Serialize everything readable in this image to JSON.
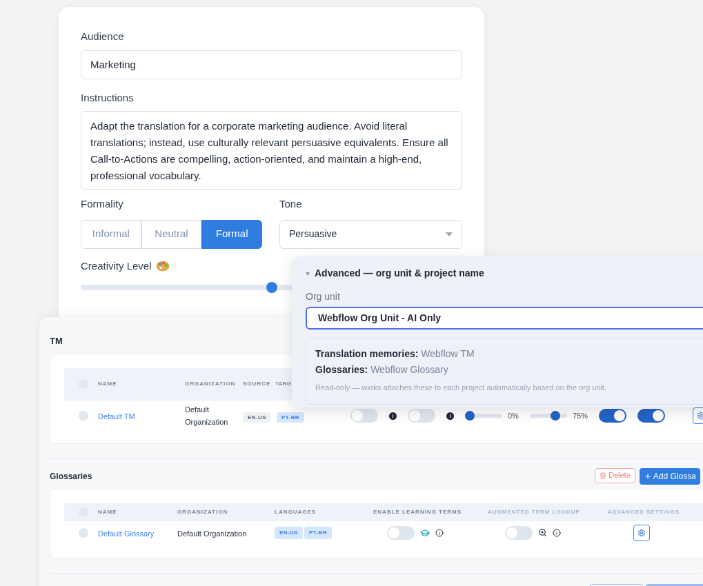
{
  "form": {
    "audience": {
      "label": "Audience",
      "value": "Marketing"
    },
    "instructions": {
      "label": "Instructions",
      "value": "Adapt the translation for a corporate marketing audience. Avoid literal translations; instead, use culturally relevant persuasive equivalents. Ensure all Call-to-Actions are compelling, action-oriented, and maintain a high-end, professional vocabulary."
    },
    "formality": {
      "label": "Formality",
      "options": [
        {
          "label": "Informal",
          "selected": false
        },
        {
          "label": "Neutral",
          "selected": false
        },
        {
          "label": "Formal",
          "selected": true
        }
      ]
    },
    "tone": {
      "label": "Tone",
      "value": "Persuasive"
    },
    "creativity": {
      "label": "Creativity Level",
      "level": 0.5
    }
  },
  "tm": {
    "title": "TM",
    "header_checked": false,
    "columns": [
      "NAME",
      "ORGANIZATION",
      "SOURCE",
      "TARG"
    ],
    "rows": [
      {
        "checked": false,
        "name": "Default TM",
        "organization": "Default Organization",
        "source": "EN-US",
        "target": "PT-BR",
        "controls": [
          {
            "kind": "toggle",
            "on": false
          },
          {
            "kind": "info"
          },
          {
            "kind": "toggle",
            "on": false
          },
          {
            "kind": "info"
          },
          {
            "kind": "slider",
            "level": 0,
            "reading": "0%"
          },
          {
            "kind": "slider",
            "level": 0.75,
            "reading": "75%"
          },
          {
            "kind": "toggle",
            "on": true
          },
          {
            "kind": "toggle",
            "on": true
          },
          {
            "kind": "settings"
          }
        ]
      }
    ]
  },
  "glossaries": {
    "title": "Glossaries",
    "header_checked": false,
    "buttons": [
      {
        "kind": "danger",
        "label": "Delete"
      },
      {
        "kind": "primary",
        "label": "Add Glossa"
      }
    ],
    "columns": [
      "NAME",
      "ORGANIZATION",
      "LANGUAGES",
      "ENABLE LEARNING TERMS",
      "AUGMENTED TERM LOOKUP",
      "ADVANCED SETTINGS"
    ],
    "rows": [
      {
        "checked": false,
        "name": "Default Glossary",
        "organization": "Default Organization",
        "languages": [
          "EN-US",
          "PT-BR"
        ],
        "learning_terms": {
          "on": false
        },
        "term_lookup": {
          "on": false
        }
      }
    ]
  },
  "advanced": {
    "title": "Advanced — org unit & project name",
    "expanded": true,
    "org_unit": {
      "label": "Org unit",
      "value": "Webflow Org Unit - AI Only"
    },
    "info": [
      {
        "label": "Translation memories:",
        "value": "Webflow TM"
      },
      {
        "label": "Glossaries:",
        "value": "Webflow Glossary"
      }
    ],
    "note": "Read-only — wxrks attaches these to each project automatically based on the org unit."
  }
}
